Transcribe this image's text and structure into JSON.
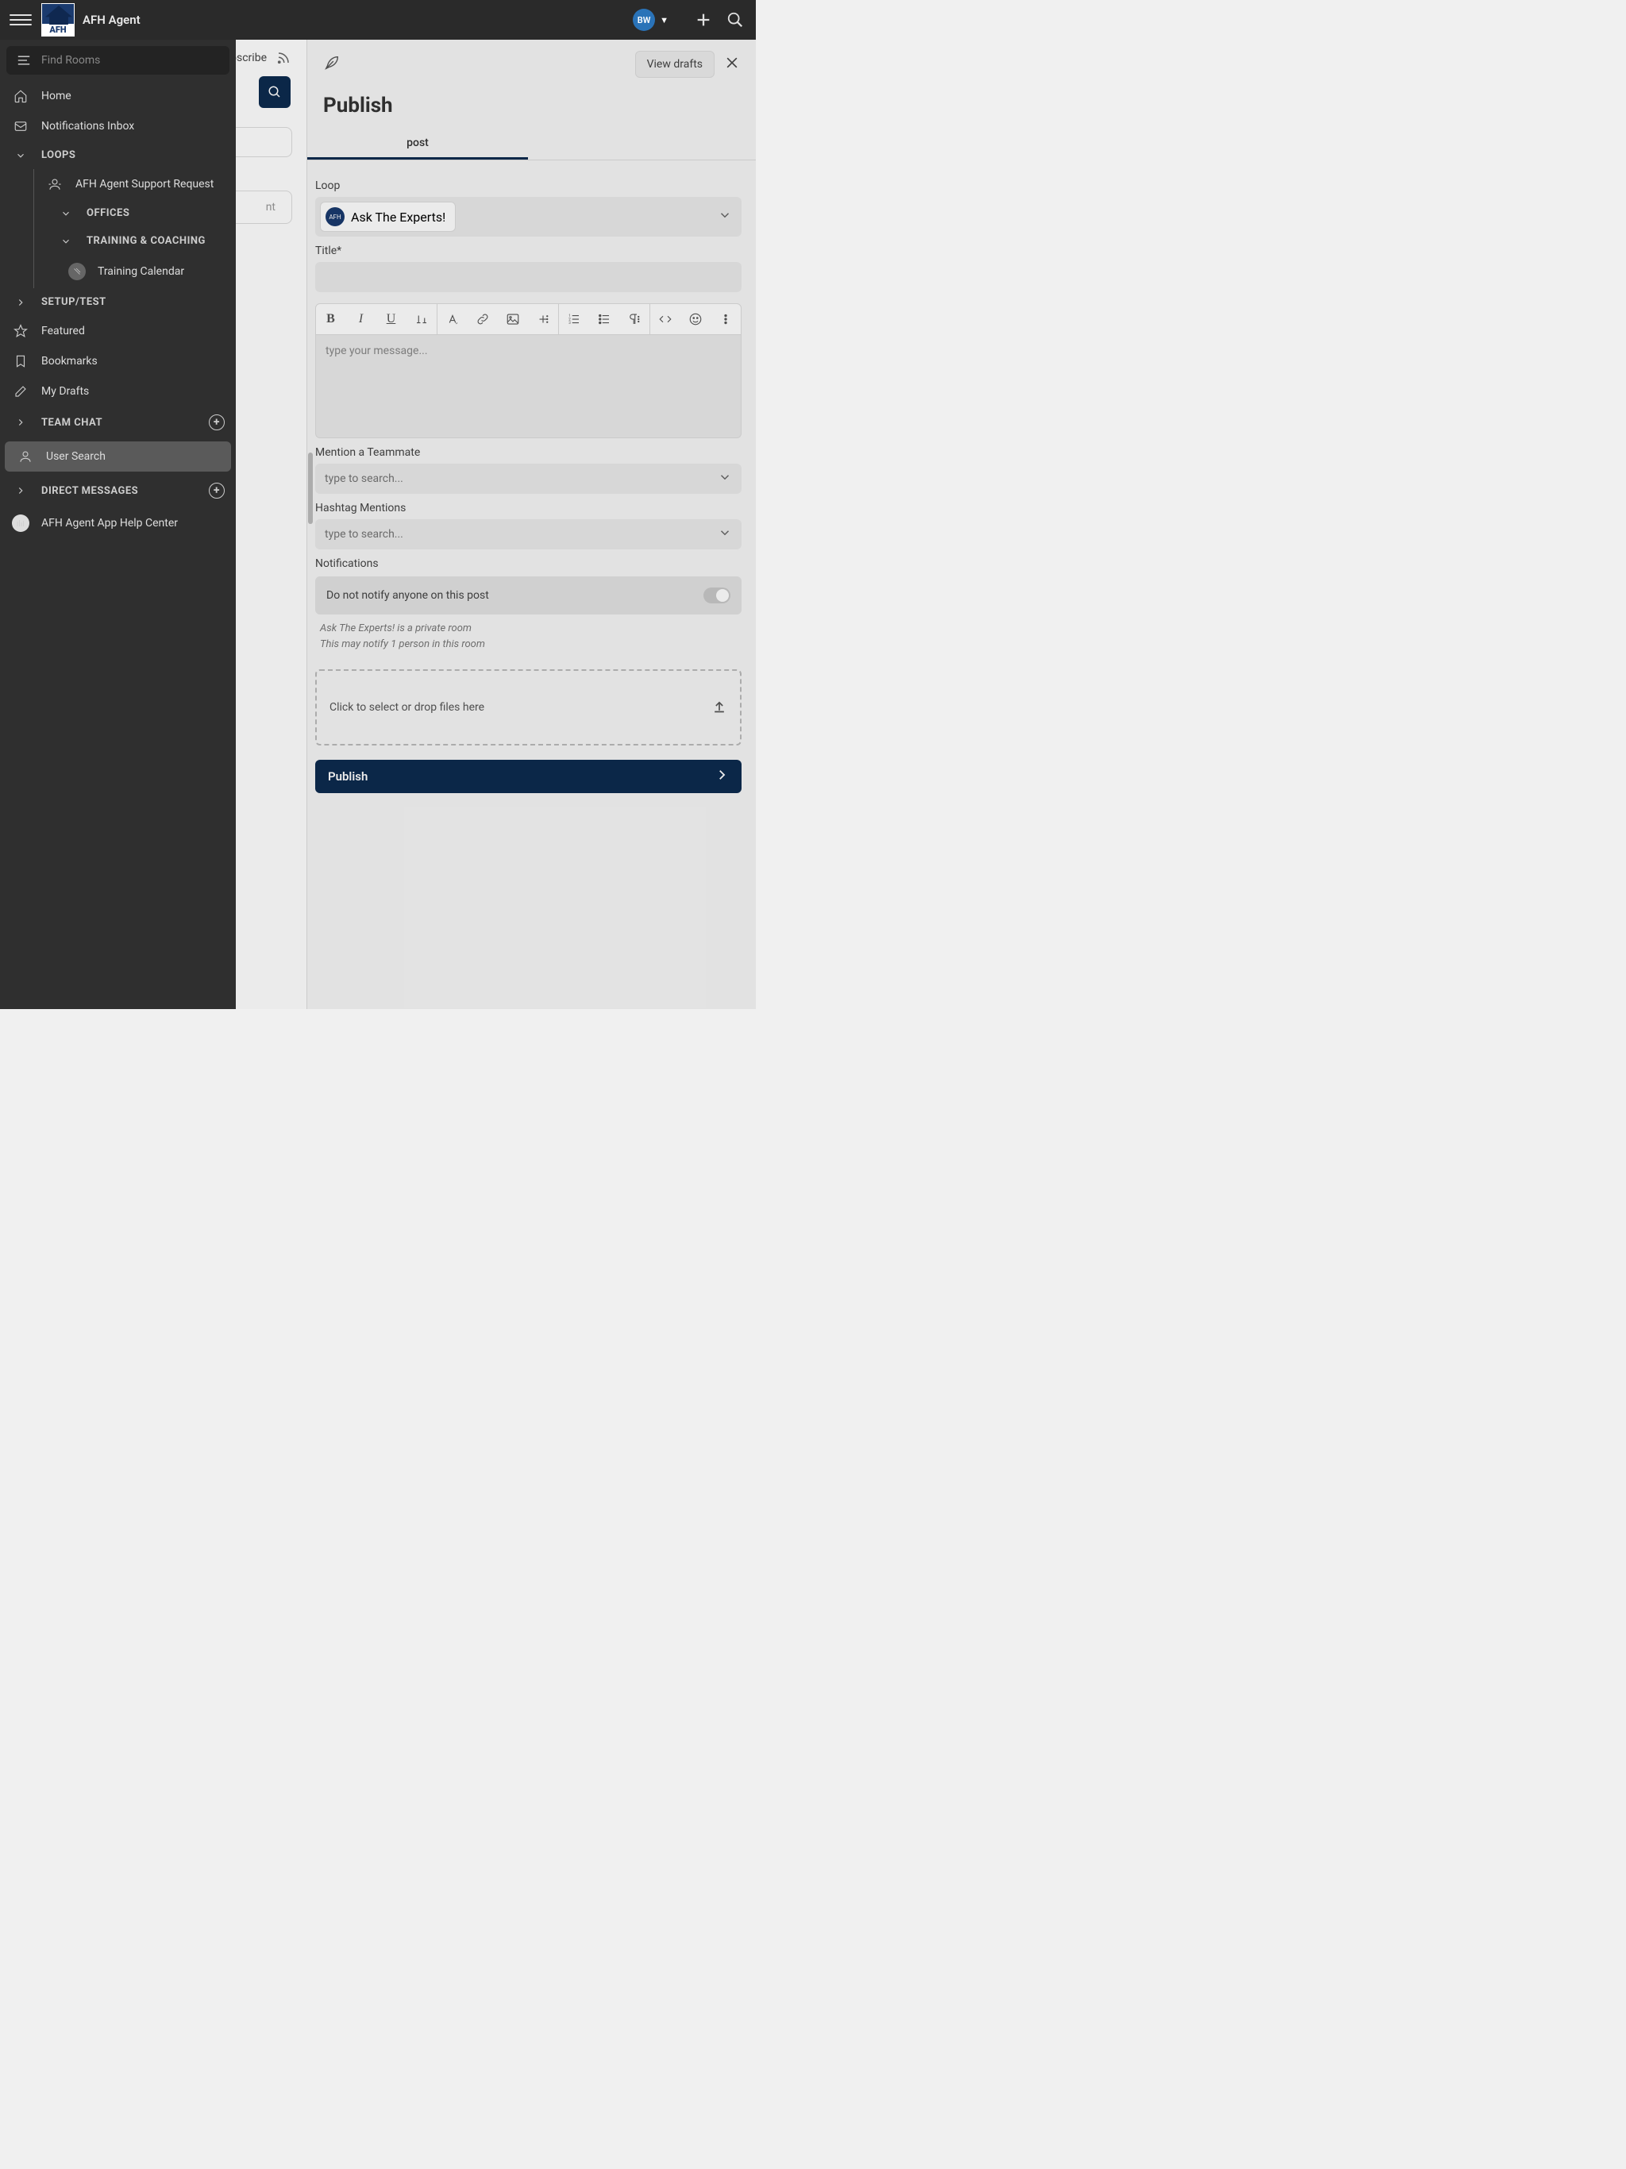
{
  "header": {
    "app_title": "AFH Agent",
    "logo_text": "AFH",
    "avatar_initials": "BW"
  },
  "sidebar": {
    "search_placeholder": "Find Rooms",
    "items": {
      "home": "Home",
      "notifications": "Notifications Inbox",
      "loops": "LOOPS",
      "support_request": "AFH Agent Support Request",
      "offices": "OFFICES",
      "training_coaching": "TRAINING & COACHING",
      "training_calendar": "Training Calendar",
      "setup_test": "SETUP/TEST",
      "featured": "Featured",
      "bookmarks": "Bookmarks",
      "my_drafts": "My Drafts",
      "team_chat": "TEAM CHAT",
      "user_search": "User Search",
      "direct_messages": "DIRECT MESSAGES",
      "help_center": "AFH Agent App Help Center"
    }
  },
  "backdrop": {
    "subscribe": "Subscribe",
    "ghost_trail": "nt"
  },
  "publish": {
    "view_drafts": "View drafts",
    "title": "Publish",
    "tab_post": "post",
    "labels": {
      "loop": "Loop",
      "title": "Title*",
      "mention": "Mention a Teammate",
      "hashtag": "Hashtag Mentions",
      "notifications": "Notifications"
    },
    "loop_chip": "Ask The Experts!",
    "loop_chip_badge": "AFH",
    "editor_placeholder": "type your message...",
    "search_placeholder": "type to search...",
    "notif_toggle_label": "Do not notify anyone on this post",
    "notif_hint_1": "Ask The Experts! is a private room",
    "notif_hint_2": "This may notify 1 person in this room",
    "dropzone": "Click to select or drop files here",
    "publish_button": "Publish"
  }
}
